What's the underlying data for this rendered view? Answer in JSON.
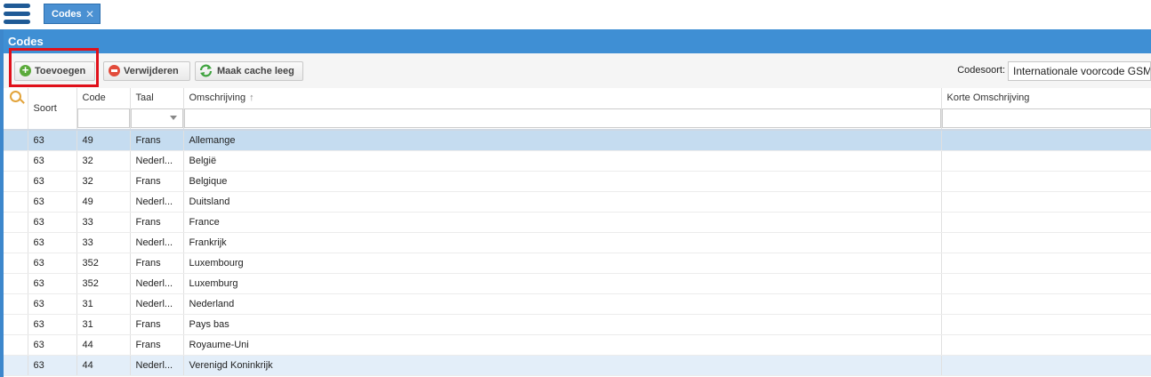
{
  "tab": {
    "label": "Codes",
    "close_glyph": "✕"
  },
  "panel": {
    "title": "Codes"
  },
  "toolbar": {
    "add_label": "Toevoegen",
    "delete_label": "Verwijderen",
    "clear_cache_label": "Maak cache leeg",
    "codesoort_label": "Codesoort:",
    "codesoort_value": "Internationale voorcode GSM"
  },
  "columns": {
    "soort": "Soort",
    "code": "Code",
    "taal": "Taal",
    "omschrijving": "Omschrijving",
    "sort_glyph": "🡑",
    "korte": "Korte Omschrijving"
  },
  "rows": [
    {
      "soort": "63",
      "code": "49",
      "taal": "Frans",
      "omschrijving": "Allemange"
    },
    {
      "soort": "63",
      "code": "32",
      "taal": "Nederl...",
      "omschrijving": "België"
    },
    {
      "soort": "63",
      "code": "32",
      "taal": "Frans",
      "omschrijving": "Belgique"
    },
    {
      "soort": "63",
      "code": "49",
      "taal": "Nederl...",
      "omschrijving": "Duitsland"
    },
    {
      "soort": "63",
      "code": "33",
      "taal": "Frans",
      "omschrijving": "France"
    },
    {
      "soort": "63",
      "code": "33",
      "taal": "Nederl...",
      "omschrijving": "Frankrijk"
    },
    {
      "soort": "63",
      "code": "352",
      "taal": "Frans",
      "omschrijving": "Luxembourg"
    },
    {
      "soort": "63",
      "code": "352",
      "taal": "Nederl...",
      "omschrijving": "Luxemburg"
    },
    {
      "soort": "63",
      "code": "31",
      "taal": "Nederl...",
      "omschrijving": "Nederland"
    },
    {
      "soort": "63",
      "code": "31",
      "taal": "Frans",
      "omschrijving": "Pays bas"
    },
    {
      "soort": "63",
      "code": "44",
      "taal": "Frans",
      "omschrijving": "Royaume-Uni"
    },
    {
      "soort": "63",
      "code": "44",
      "taal": "Nederl...",
      "omschrijving": "Verenigd Koninkrijk"
    }
  ],
  "colors": {
    "accent": "#3f8fd4",
    "selected_row": "#c5dcf0",
    "highlight": "#e0101a"
  },
  "icons": [
    "menu-icon",
    "close-icon",
    "add-icon",
    "delete-icon",
    "refresh-icon",
    "search-icon",
    "sort-asc-icon",
    "chevron-down-icon"
  ]
}
